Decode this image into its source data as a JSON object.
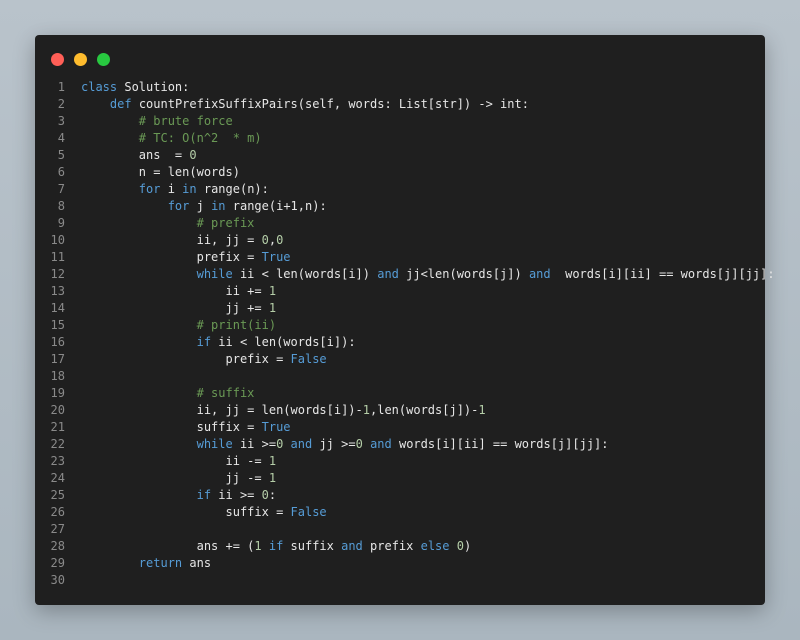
{
  "window": {
    "controls": [
      "close",
      "minimize",
      "maximize"
    ],
    "colors": {
      "background": "#1f1f1f",
      "keyword": "#569cd6",
      "comment": "#6a9955",
      "number": "#b5cea8",
      "text": "#e6e6e6",
      "line_number": "#8a8a8a"
    }
  },
  "code": {
    "lines": [
      {
        "n": "1",
        "tokens": [
          {
            "t": "kw",
            "v": "class"
          },
          {
            "t": "tx",
            "v": " Solution:"
          }
        ]
      },
      {
        "n": "2",
        "tokens": [
          {
            "t": "tx",
            "v": "    "
          },
          {
            "t": "kw",
            "v": "def"
          },
          {
            "t": "tx",
            "v": " countPrefixSuffixPairs(self, words: List[str]) -> int:"
          }
        ]
      },
      {
        "n": "3",
        "tokens": [
          {
            "t": "tx",
            "v": "        "
          },
          {
            "t": "cm",
            "v": "# brute force"
          }
        ]
      },
      {
        "n": "4",
        "tokens": [
          {
            "t": "tx",
            "v": "        "
          },
          {
            "t": "cm",
            "v": "# TC: O(n^2  * m)"
          }
        ]
      },
      {
        "n": "5",
        "tokens": [
          {
            "t": "tx",
            "v": "        ans  = "
          },
          {
            "t": "num",
            "v": "0"
          }
        ]
      },
      {
        "n": "6",
        "tokens": [
          {
            "t": "tx",
            "v": "        n = len(words)"
          }
        ]
      },
      {
        "n": "7",
        "tokens": [
          {
            "t": "tx",
            "v": "        "
          },
          {
            "t": "kw",
            "v": "for"
          },
          {
            "t": "tx",
            "v": " i "
          },
          {
            "t": "kw",
            "v": "in"
          },
          {
            "t": "tx",
            "v": " range(n):"
          }
        ]
      },
      {
        "n": "8",
        "tokens": [
          {
            "t": "tx",
            "v": "            "
          },
          {
            "t": "kw",
            "v": "for"
          },
          {
            "t": "tx",
            "v": " j "
          },
          {
            "t": "kw",
            "v": "in"
          },
          {
            "t": "tx",
            "v": " range(i+1,n):"
          }
        ]
      },
      {
        "n": "9",
        "tokens": [
          {
            "t": "tx",
            "v": "                "
          },
          {
            "t": "cm",
            "v": "# prefix"
          }
        ]
      },
      {
        "n": "10",
        "tokens": [
          {
            "t": "tx",
            "v": "                ii, jj = "
          },
          {
            "t": "num",
            "v": "0"
          },
          {
            "t": "tx",
            "v": ","
          },
          {
            "t": "num",
            "v": "0"
          }
        ]
      },
      {
        "n": "11",
        "tokens": [
          {
            "t": "tx",
            "v": "                prefix = "
          },
          {
            "t": "kw",
            "v": "True"
          }
        ]
      },
      {
        "n": "12",
        "tokens": [
          {
            "t": "tx",
            "v": "                "
          },
          {
            "t": "kw",
            "v": "while"
          },
          {
            "t": "tx",
            "v": " ii < len(words[i]) "
          },
          {
            "t": "kw",
            "v": "and"
          },
          {
            "t": "tx",
            "v": " jj<len(words[j]) "
          },
          {
            "t": "kw",
            "v": "and"
          },
          {
            "t": "tx",
            "v": "  words[i][ii] == words[j][jj]:"
          }
        ]
      },
      {
        "n": "13",
        "tokens": [
          {
            "t": "tx",
            "v": "                    ii += "
          },
          {
            "t": "num",
            "v": "1"
          }
        ]
      },
      {
        "n": "14",
        "tokens": [
          {
            "t": "tx",
            "v": "                    jj += "
          },
          {
            "t": "num",
            "v": "1"
          }
        ]
      },
      {
        "n": "15",
        "tokens": [
          {
            "t": "tx",
            "v": "                "
          },
          {
            "t": "cm",
            "v": "# print(ii)"
          }
        ]
      },
      {
        "n": "16",
        "tokens": [
          {
            "t": "tx",
            "v": "                "
          },
          {
            "t": "kw",
            "v": "if"
          },
          {
            "t": "tx",
            "v": " ii < len(words[i]):"
          }
        ]
      },
      {
        "n": "17",
        "tokens": [
          {
            "t": "tx",
            "v": "                    prefix = "
          },
          {
            "t": "kw",
            "v": "False"
          }
        ]
      },
      {
        "n": "18",
        "tokens": []
      },
      {
        "n": "19",
        "tokens": [
          {
            "t": "tx",
            "v": "                "
          },
          {
            "t": "cm",
            "v": "# suffix"
          }
        ]
      },
      {
        "n": "20",
        "tokens": [
          {
            "t": "tx",
            "v": "                ii, jj = len(words[i])-"
          },
          {
            "t": "num",
            "v": "1"
          },
          {
            "t": "tx",
            "v": ",len(words[j])-"
          },
          {
            "t": "num",
            "v": "1"
          }
        ]
      },
      {
        "n": "21",
        "tokens": [
          {
            "t": "tx",
            "v": "                suffix = "
          },
          {
            "t": "kw",
            "v": "True"
          }
        ]
      },
      {
        "n": "22",
        "tokens": [
          {
            "t": "tx",
            "v": "                "
          },
          {
            "t": "kw",
            "v": "while"
          },
          {
            "t": "tx",
            "v": " ii >="
          },
          {
            "t": "num",
            "v": "0"
          },
          {
            "t": "tx",
            "v": " "
          },
          {
            "t": "kw",
            "v": "and"
          },
          {
            "t": "tx",
            "v": " jj >="
          },
          {
            "t": "num",
            "v": "0"
          },
          {
            "t": "tx",
            "v": " "
          },
          {
            "t": "kw",
            "v": "and"
          },
          {
            "t": "tx",
            "v": " words[i][ii] == words[j][jj]:"
          }
        ]
      },
      {
        "n": "23",
        "tokens": [
          {
            "t": "tx",
            "v": "                    ii -= "
          },
          {
            "t": "num",
            "v": "1"
          }
        ]
      },
      {
        "n": "24",
        "tokens": [
          {
            "t": "tx",
            "v": "                    jj -= "
          },
          {
            "t": "num",
            "v": "1"
          }
        ]
      },
      {
        "n": "25",
        "tokens": [
          {
            "t": "tx",
            "v": "                "
          },
          {
            "t": "kw",
            "v": "if"
          },
          {
            "t": "tx",
            "v": " ii >= "
          },
          {
            "t": "num",
            "v": "0"
          },
          {
            "t": "tx",
            "v": ":"
          }
        ]
      },
      {
        "n": "26",
        "tokens": [
          {
            "t": "tx",
            "v": "                    suffix = "
          },
          {
            "t": "kw",
            "v": "False"
          }
        ]
      },
      {
        "n": "27",
        "tokens": []
      },
      {
        "n": "28",
        "tokens": [
          {
            "t": "tx",
            "v": "                ans += ("
          },
          {
            "t": "num",
            "v": "1"
          },
          {
            "t": "tx",
            "v": " "
          },
          {
            "t": "kw",
            "v": "if"
          },
          {
            "t": "tx",
            "v": " suffix "
          },
          {
            "t": "kw",
            "v": "and"
          },
          {
            "t": "tx",
            "v": " prefix "
          },
          {
            "t": "kw",
            "v": "else"
          },
          {
            "t": "tx",
            "v": " "
          },
          {
            "t": "num",
            "v": "0"
          },
          {
            "t": "tx",
            "v": ")"
          }
        ]
      },
      {
        "n": "29",
        "tokens": [
          {
            "t": "tx",
            "v": "        "
          },
          {
            "t": "kw",
            "v": "return"
          },
          {
            "t": "tx",
            "v": " ans"
          }
        ]
      },
      {
        "n": "30",
        "tokens": []
      }
    ]
  }
}
